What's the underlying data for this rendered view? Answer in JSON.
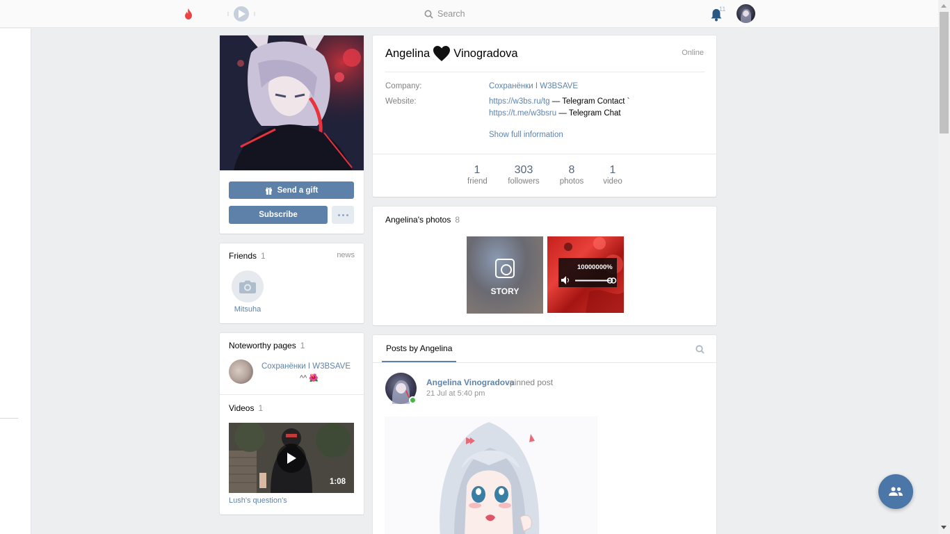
{
  "topbar": {
    "search_label": "Search",
    "notifications_count": "11"
  },
  "profile": {
    "first_name": "Angelina",
    "last_name": "Vinogradova",
    "status": "Online",
    "company_label": "Company:",
    "company_value": "Сохранёнки I W3BSAVE",
    "website_label": "Website:",
    "website_links": [
      {
        "url": "https://w3bs.ru/tg",
        "desc": " — Telegram Contact `"
      },
      {
        "url": "https://t.me/w3bsru",
        "desc": " — Telegram Chat"
      }
    ],
    "show_full_label": "Show full information",
    "counters": [
      {
        "num": "1",
        "label": "friend"
      },
      {
        "num": "303",
        "label": "followers"
      },
      {
        "num": "8",
        "label": "photos"
      },
      {
        "num": "1",
        "label": "video"
      }
    ]
  },
  "actions": {
    "gift_label": "Send a gift",
    "subscribe_label": "Subscribe"
  },
  "friends": {
    "title": "Friends",
    "count": "1",
    "news_label": "news",
    "items": [
      {
        "name": "Mitsuha"
      }
    ]
  },
  "pages": {
    "title": "Noteworthy pages",
    "count": "1",
    "items": [
      {
        "name": "Сохранёнки I W3BSAVE",
        "sub": "^^ 🌺"
      }
    ]
  },
  "videos": {
    "title": "Videos",
    "count": "1",
    "items": [
      {
        "title": "Lush's question's",
        "duration": "1:08"
      }
    ]
  },
  "photos": {
    "title": "Angelina's photos",
    "count": "8",
    "story_label": "STORY",
    "volume_label": "10000000%"
  },
  "posts": {
    "tab_label": "Posts by Angelina",
    "author": "Angelina Vinogradova",
    "pinned_label": "pinned post",
    "date": "21 Jul at 5:40 pm"
  },
  "colors": {
    "accent": "#5d81a8",
    "link": "#5f83aa",
    "online": "#4bb34b"
  }
}
